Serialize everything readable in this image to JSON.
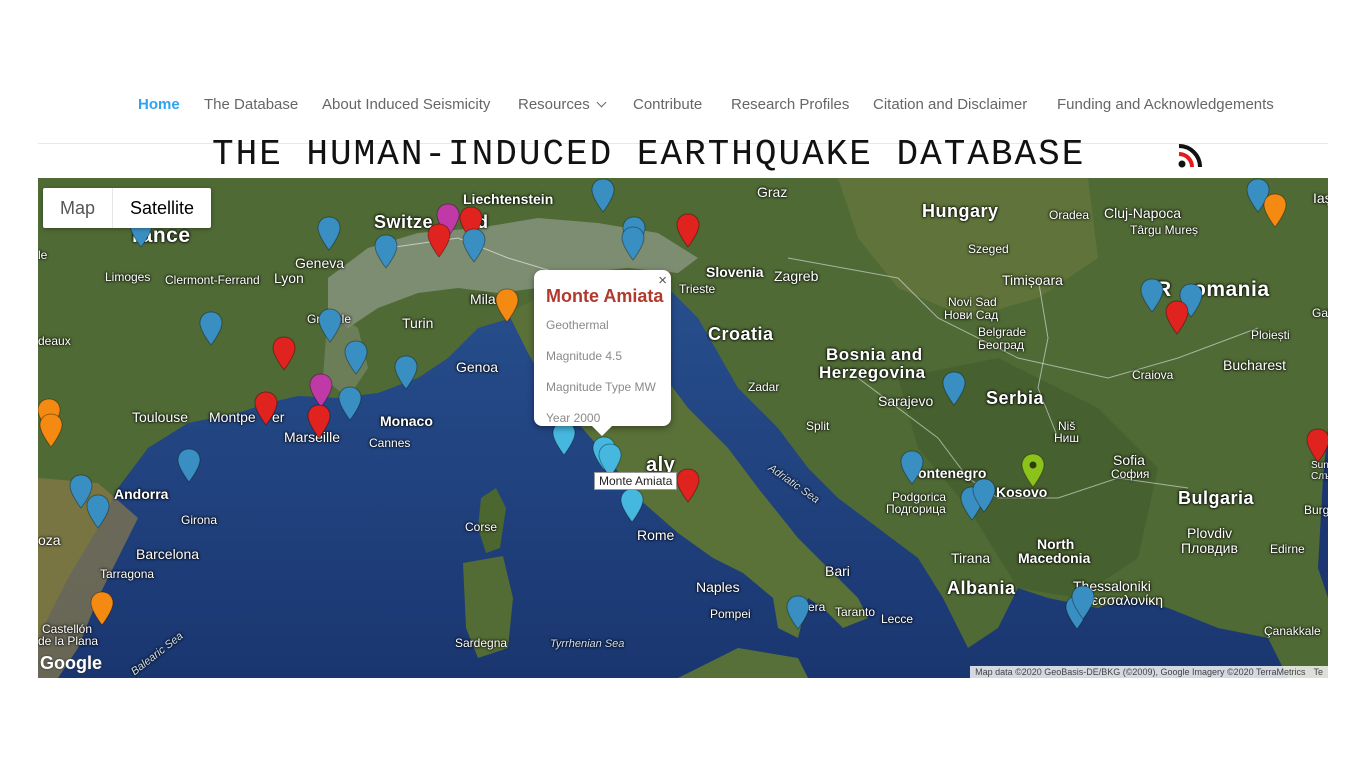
{
  "nav": {
    "items": [
      {
        "label": "Home",
        "active": true
      },
      {
        "label": "The Database"
      },
      {
        "label": "About Induced Seismicity"
      },
      {
        "label": "Resources"
      },
      {
        "label": "Contribute"
      },
      {
        "label": "Research Profiles"
      },
      {
        "label": "Citation and Disclaimer"
      },
      {
        "label": "Funding and Acknowledgements"
      }
    ]
  },
  "site_title": "THE HUMAN-INDUCED EARTHQUAKE DATABASE",
  "map": {
    "type_control": {
      "map_label": "Map",
      "satellite_label": "Satellite"
    },
    "labels": {
      "france": "rance",
      "switzerland": "Switze",
      "switzerland_end": "d",
      "liechtenstein": "Liechtenstein",
      "graz": "Graz",
      "hungary": "Hungary",
      "oradea": "Oradea",
      "cluj": "Cluj-Napoca",
      "targu": "Târgu Mureș",
      "iasi": "Iași",
      "geneva": "Geneva",
      "lyon": "Lyon",
      "limoges": "Limoges",
      "clermont": "Clermont-Ferrand",
      "le": "le",
      "slovenia": "Slovenia",
      "zagreb": "Zagreb",
      "szeged": "Szeged",
      "timisoara": "Timișoara",
      "romania_r": "R",
      "romania": "omania",
      "gal": "Gal",
      "milan": "Mila",
      "trieste": "Trieste",
      "croatia": "Croatia",
      "grenoble": "Gre",
      "grenoble_end": "ble",
      "turin": "Turin",
      "novi_sad": "Novi Sad",
      "novi_sad_cyr": "Нови Сад",
      "belgrade": "Belgrade",
      "belgrade_cyr": "Београд",
      "ploiesti": "Ploiești",
      "bordeaux": "deaux",
      "bosnia": "Bosnia and",
      "herzegovina": "Herzegovina",
      "bucharest": "Bucharest",
      "genoa": "Genoa",
      "zadar": "Zadar",
      "craiova": "Craiova",
      "sarajevo": "Sarajevo",
      "serbia": "Serbia",
      "toulouse": "Toulouse",
      "montpellier": "Montpe",
      "montpellier_end": "er",
      "monaco": "Monaco",
      "marseille": "Marseille",
      "cannes": "Cannes",
      "split": "Split",
      "nis": "Niš",
      "nis_cyr": "Ниш",
      "sofia": "Sofia",
      "sofia_cyr": "София",
      "montenegro": "ontenegro",
      "italy": "aly",
      "kosovo": "Kosovo",
      "andorra": "Andorra",
      "bulgaria": "Bulgaria",
      "girona": "Girona",
      "corse": "Corse",
      "podgorica": "Podgorica",
      "podgorica_cyr": "Подгорица",
      "burgas": "Burga",
      "zoza": "oza",
      "rome": "Rome",
      "tirana": "Tirana",
      "north": "North",
      "macedonia": "Macedonia",
      "plovdiv": "Plovdiv",
      "plovdiv_cyr": "Пловдив",
      "edirne": "Edirne",
      "barcelona": "Barcelona",
      "bari": "Bari",
      "tarragona": "Tarragona",
      "albania": "Albania",
      "naples": "Naples",
      "thessaloniki": "Thessaloniki",
      "thessaloniki_gr": "Θεσσαλονίκη",
      "taranto": "Taranto",
      "pompei": "Pompei",
      "lecce": "Lecce",
      "castellon": "Castellón",
      "la_plana": "de la Plana",
      "canakkale": "Çanakkale",
      "sardegna": "Sardegna",
      "tyrrhenian": "Tyrrhenian Sea",
      "balearic": "Balearic Sea",
      "adriatic": "Adriatic Sea",
      "sunny": "Sunny",
      "sunny_cyr": "Слънч",
      "ba": "Ba",
      "o": "o",
      "ica": "ica",
      "era": "era"
    },
    "info_window": {
      "title": "Monte Amiata",
      "project_type": "Geothermal",
      "magnitude": "Magnitude 4.5",
      "magnitude_type": "Magnitude Type MW",
      "year": "Year 2000",
      "close_symbol": "×"
    },
    "tooltip": "Monte Amiata",
    "attribution": "Map data ©2020 GeoBasis-DE/BKG (©2009), Google Imagery ©2020 TerraMetrics",
    "attribution_extra": "Te",
    "google_logo": "Google",
    "colors": {
      "blue": "#3a8fc2",
      "red": "#e0231e",
      "orange": "#f58a12",
      "magenta": "#c03aa7",
      "cyan": "#46b8e0",
      "green": "#8cc21c"
    }
  }
}
